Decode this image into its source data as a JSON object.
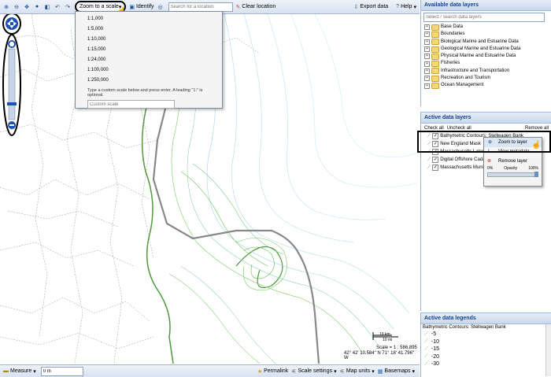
{
  "toolbar": {
    "zoom_scale_label": "Zoom to a scale",
    "identify_label": "Identify",
    "search_placeholder": "Search for a location",
    "clear_label": "Clear location",
    "export_label": "Export data",
    "help_label": "Help"
  },
  "scale_dropdown": {
    "options": [
      "1:1,000",
      "1:5,000",
      "1:10,000",
      "1:15,000",
      "1:24,000",
      "1:100,000",
      "1:250,000"
    ],
    "hint": "Type a custom scale below and press enter. A leading \"1:\" is optional.",
    "custom_placeholder": "Custom scale"
  },
  "available_layers": {
    "title": "Available data layers",
    "search_placeholder": "Select / search data layers",
    "items": [
      "Base Data",
      "Boundaries",
      "Biological Marine and Estuarine Data",
      "Geological Marine and Estuarine Data",
      "Physical Marine and Estuarine Data",
      "Fisheries",
      "Infrastructure and Transportation",
      "Recreation and Tourism",
      "Ocean Management"
    ]
  },
  "active_layers": {
    "title": "Active data layers",
    "check_all": "Check all",
    "uncheck_all": "Uncheck all",
    "remove_all": "Remove all",
    "items": [
      "Bathymetric Contours: Stellwagen Bank",
      "New England Mask",
      "Massachusetts Lateral",
      "Digital Offshore Cadastre",
      "Massachusetts Municipal"
    ]
  },
  "context_menu": {
    "zoom": "Zoom to layer",
    "metadata": "View metadata",
    "remove": "Remove layer",
    "opacity_label": "Opacity",
    "opacity_min": "0%",
    "opacity_max": "100%"
  },
  "legend": {
    "title": "Active data legends",
    "layer_name": "Bathymetric Contours: Stellwagen Bank",
    "items": [
      "-5",
      "-10",
      "-15",
      "-20",
      "-30"
    ]
  },
  "map": {
    "scale_km": "10 km",
    "scale_mi": "10 mi",
    "scale_text": "Scale = 1 : 586,895",
    "coords": "42° 42' 10.584\" N 71° 18' 41.796\" W"
  },
  "statusbar": {
    "measure_label": "Measure",
    "measure_value": "0 m",
    "permalink": "Permalink",
    "scale_settings": "Scale settings",
    "map_units": "Map units",
    "basemaps": "Basemaps"
  }
}
